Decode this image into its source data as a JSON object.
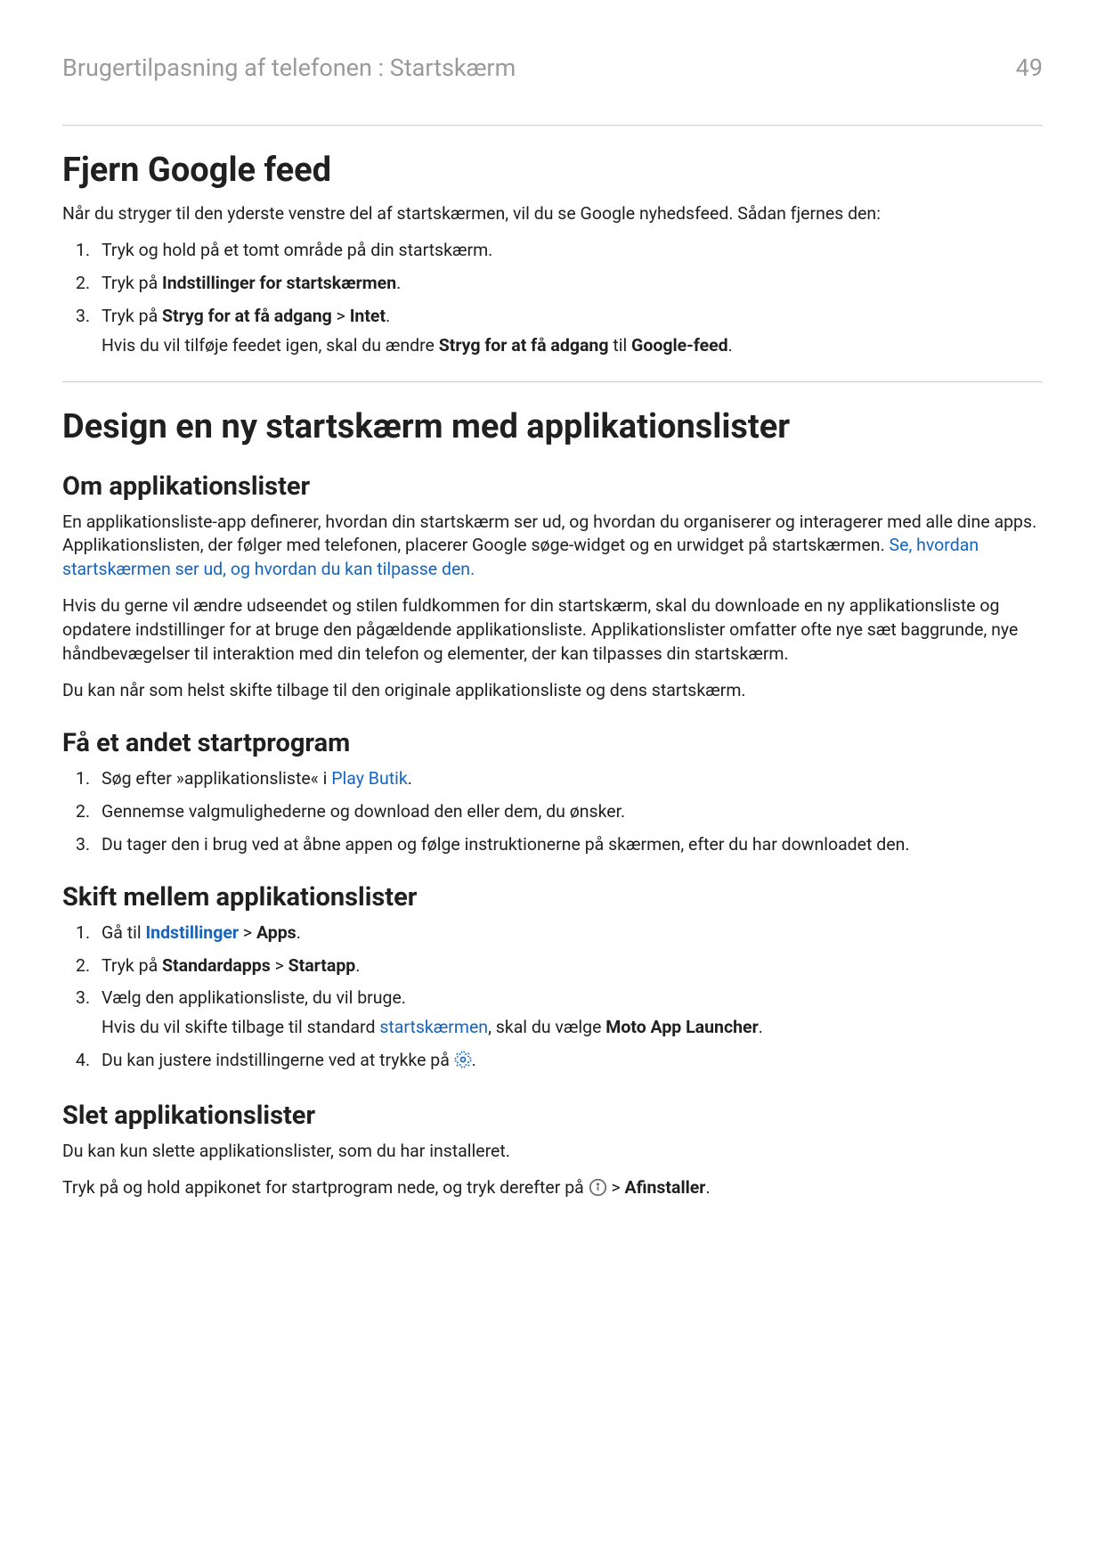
{
  "header": {
    "breadcrumb": "Brugertilpasning af telefonen : Startskærm",
    "page_number": "49"
  },
  "section1": {
    "title": "Fjern Google feed",
    "intro": "Når du stryger til den yderste venstre del af startskærmen, vil du se Google nyhedsfeed. Sådan fjernes den:",
    "steps": {
      "s1": "Tryk og hold på et tomt område på din startskærm.",
      "s2_pre": "Tryk på ",
      "s2_b": "Indstillinger for startskærmen",
      "s2_post": ".",
      "s3_pre": "Tryk på ",
      "s3_b1": "Stryg for at få adgang",
      "s3_sep": " > ",
      "s3_b2": "Intet",
      "s3_post": ".",
      "s3_sub_pre": "Hvis du vil tilføje feedet igen, skal du ændre ",
      "s3_sub_b1": "Stryg for at få adgang",
      "s3_sub_mid": " til ",
      "s3_sub_b2": "Google-feed",
      "s3_sub_post": "."
    }
  },
  "section2": {
    "title": "Design en ny startskærm med applikationslister",
    "sub_a": {
      "title": "Om applikationslister",
      "p1_pre": "En applikationsliste-app definerer, hvordan din startskærm ser ud, og hvordan du organiserer og interagerer med alle dine apps. Applikationslisten, der følger med telefonen, placerer Google søge-widget og en urwidget på startskærmen. ",
      "p1_link": "Se, hvordan startskærmen ser ud, og hvordan du kan tilpasse den.",
      "p2": "Hvis du gerne vil ændre udseendet og stilen fuldkommen for din startskærm, skal du downloade en ny applikationsliste og opdatere indstillinger for at bruge den pågældende applikationsliste. Applikationslister omfatter ofte nye sæt baggrunde, nye håndbevægelser til interaktion med din telefon og elementer, der kan tilpasses din startskærm.",
      "p3": "Du kan når som helst skifte tilbage til den originale applikationsliste og dens startskærm."
    },
    "sub_b": {
      "title": "Få et andet startprogram",
      "s1_pre": "Søg efter »applikationsliste« i ",
      "s1_link": "Play Butik",
      "s1_post": ".",
      "s2": "Gennemse valgmulighederne og download den eller dem, du ønsker.",
      "s3": "Du tager den i brug ved at åbne appen og følge instruktionerne på skærmen, efter du har downloadet den."
    },
    "sub_c": {
      "title": "Skift mellem applikationslister",
      "s1_pre": "Gå til ",
      "s1_link": "Indstillinger",
      "s1_sep": " > ",
      "s1_b": "Apps",
      "s1_post": ".",
      "s2_pre": "Tryk på ",
      "s2_b1": "Standardapps",
      "s2_sep": " > ",
      "s2_b2": "Startapp",
      "s2_post": ".",
      "s3": "Vælg den applikationsliste, du vil bruge.",
      "s3_sub_pre": "Hvis du vil skifte tilbage til standard ",
      "s3_sub_link": "startskærmen",
      "s3_sub_mid": ", skal du vælge ",
      "s3_sub_b": "Moto App Launcher",
      "s3_sub_post": ".",
      "s4_pre": "Du kan justere indstillingerne ved at trykke på ",
      "s4_post": "."
    },
    "sub_d": {
      "title": "Slet applikationslister",
      "p1": "Du kan kun slette applikationslister, som du har installeret.",
      "p2_pre": "Tryk på og hold appikonet for startprogram nede, og tryk derefter på ",
      "p2_sep": " > ",
      "p2_b": "Afinstaller",
      "p2_post": "."
    }
  },
  "icons": {
    "gear": "settings-gear-icon",
    "info": "info-circle-icon"
  }
}
